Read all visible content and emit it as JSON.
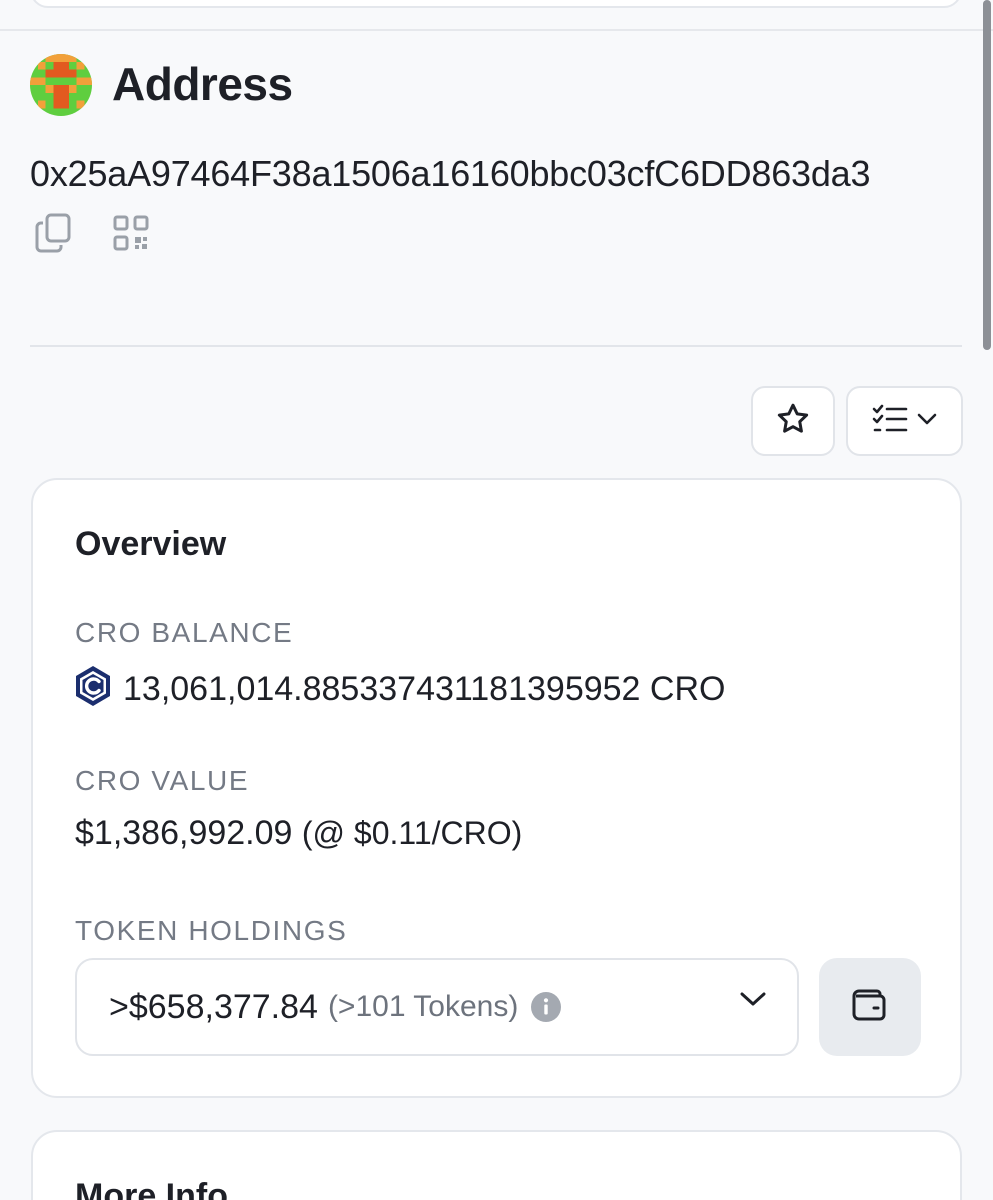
{
  "header": {
    "title": "Address",
    "address": "0x25aA97464F38a1506a16160bbc03cfC6DD863da3",
    "icons": {
      "copy": "copy-icon",
      "qr": "qr-code-icon"
    }
  },
  "actions": {
    "favorite_icon": "star-icon",
    "list_icon": "checklist-icon",
    "dropdown_icon": "chevron-down-icon"
  },
  "overview": {
    "title": "Overview",
    "balance_label": "CRO BALANCE",
    "balance_value": "13,061,014.885337431181395952 CRO",
    "value_label": "CRO VALUE",
    "value_amount": "$1,386,992.09",
    "value_rate": "(@ $0.11/CRO)",
    "token_label": "TOKEN HOLDINGS",
    "token_amount": ">$658,377.84",
    "token_count": "(>101 Tokens)",
    "icons": {
      "cro": "cro-logo-icon",
      "info": "info-icon",
      "wallet": "wallet-icon"
    }
  },
  "more_info": {
    "title": "More Info"
  },
  "colors": {
    "background": "#f8f9fb",
    "card": "#ffffff",
    "border": "#e4e7ec",
    "text": "#1e2027",
    "muted": "#747a85",
    "cro_blue": "#1b2e6e"
  }
}
